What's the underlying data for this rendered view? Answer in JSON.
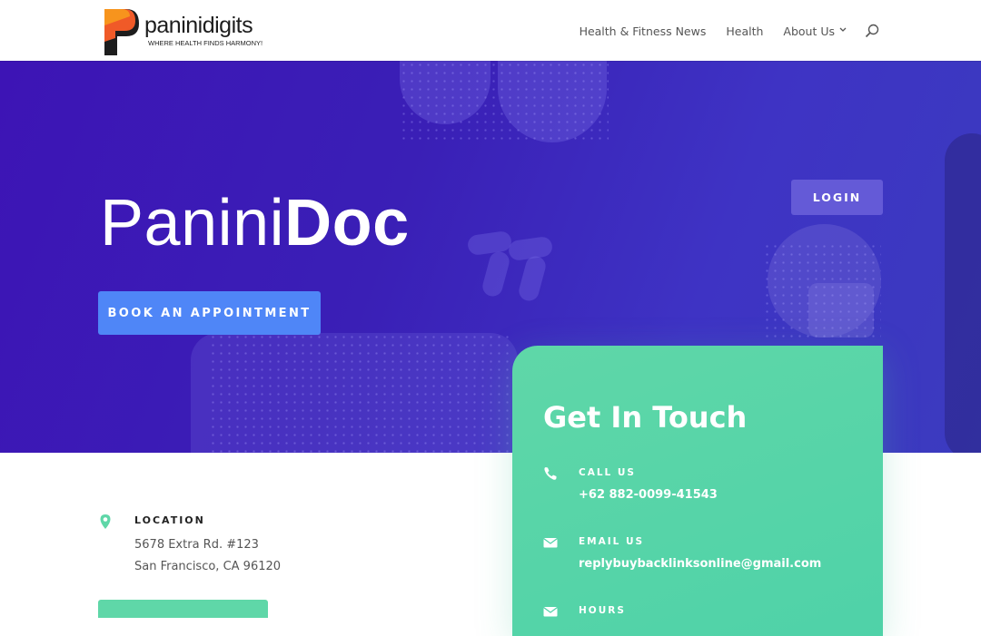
{
  "header": {
    "logo_name": "paninidigits",
    "logo_tagline": "WHERE HEALTH FINDS HARMONY!",
    "nav": [
      {
        "label": "Health & Fitness News"
      },
      {
        "label": "Health"
      },
      {
        "label": "About Us",
        "has_dropdown": true
      }
    ],
    "search_icon": "search-icon"
  },
  "hero": {
    "title_light": "Panini",
    "title_bold": "Doc",
    "book_button": "BOOK AN APPOINTMENT",
    "login_button": "LOGIN"
  },
  "contact": {
    "title": "Get In Touch",
    "items": [
      {
        "icon": "phone-icon",
        "label": "CALL US",
        "value": "+62 882-0099-41543"
      },
      {
        "icon": "envelope-icon",
        "label": "EMAIL US",
        "value": "replybuybacklinksonline@gmail.com"
      },
      {
        "icon": "envelope-icon",
        "label": "HOURS",
        "value": ""
      }
    ]
  },
  "location": {
    "icon": "map-pin-icon",
    "label": "LOCATION",
    "line1": "5678 Extra Rd. #123",
    "line2": "San Francisco, CA 96120"
  },
  "colors": {
    "hero_bg": "#3d14b5",
    "accent_blue": "#4f86f7",
    "accent_green": "#5fd7a8"
  }
}
